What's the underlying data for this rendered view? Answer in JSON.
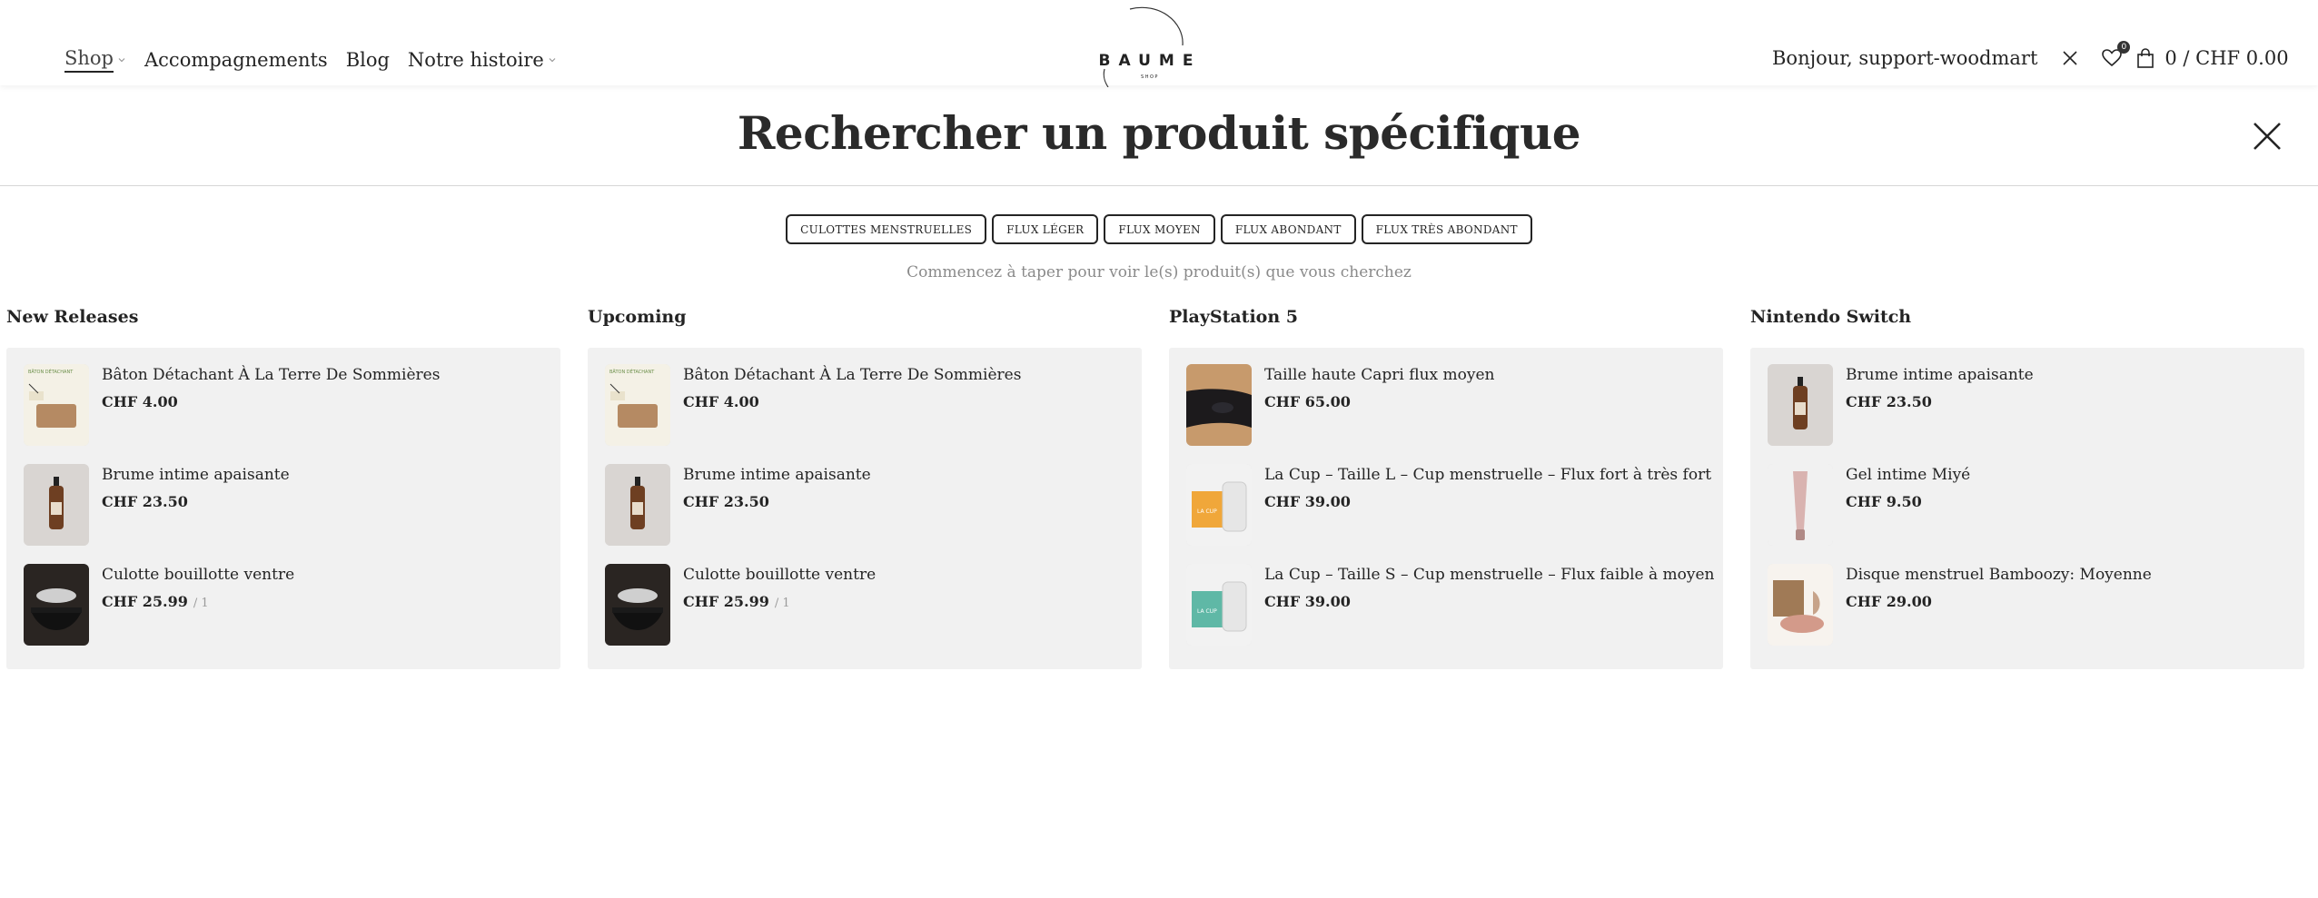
{
  "nav": {
    "items": [
      {
        "label": "Shop",
        "has_dropdown": true,
        "active": true
      },
      {
        "label": "Accompagnements",
        "has_dropdown": false
      },
      {
        "label": "Blog",
        "has_dropdown": false
      },
      {
        "label": "Notre histoire",
        "has_dropdown": true
      }
    ]
  },
  "logo": {
    "text": "BAUME",
    "subtext": "SHOP"
  },
  "account": {
    "greeting": "Bonjour, support-woodmart",
    "wishlist_count": "0",
    "cart_text": "0 / CHF 0.00"
  },
  "search": {
    "title": "Rechercher un produit spécifique",
    "tags": [
      "CULOTTES MENSTRUELLES",
      "FLUX LÉGER",
      "FLUX MOYEN",
      "FLUX ABONDANT",
      "FLUX TRÈS ABONDANT"
    ],
    "hint": "Commencez à taper pour voir le(s) produit(s) que vous cherchez"
  },
  "columns": [
    {
      "title": "New Releases",
      "products": [
        {
          "name": "Bâton Détachant À La Terre De Sommières",
          "price": "CHF 4.00",
          "qty": "",
          "thumb": "baton-thumb"
        },
        {
          "name": "Brume intime apaisante",
          "price": "CHF 23.50",
          "qty": "",
          "thumb": "spray-bottle-thumb"
        },
        {
          "name": "Culotte bouillotte ventre",
          "price": "CHF 25.99",
          "qty": "/ 1",
          "thumb": "culotte-thumb"
        }
      ]
    },
    {
      "title": "Upcoming",
      "products": [
        {
          "name": "Bâton Détachant À La Terre De Sommières",
          "price": "CHF 4.00",
          "qty": "",
          "thumb": "baton-thumb"
        },
        {
          "name": "Brume intime apaisante",
          "price": "CHF 23.50",
          "qty": "",
          "thumb": "spray-bottle-thumb"
        },
        {
          "name": "Culotte bouillotte ventre",
          "price": "CHF 25.99",
          "qty": "/ 1",
          "thumb": "culotte-thumb"
        }
      ]
    },
    {
      "title": "PlayStation 5",
      "products": [
        {
          "name": "Taille haute Capri flux moyen",
          "price": "CHF 65.00",
          "qty": "",
          "thumb": "capri-thumb"
        },
        {
          "name": "La Cup – Taille L – Cup menstruelle – Flux fort à très fort",
          "price": "CHF 39.00",
          "qty": "",
          "thumb": "cup-orange-thumb"
        },
        {
          "name": "La Cup – Taille S – Cup menstruelle – Flux faible à moyen",
          "price": "CHF 39.00",
          "qty": "",
          "thumb": "cup-teal-thumb"
        }
      ]
    },
    {
      "title": "Nintendo Switch",
      "products": [
        {
          "name": "Brume intime apaisante",
          "price": "CHF 23.50",
          "qty": "",
          "thumb": "spray-bottle-thumb"
        },
        {
          "name": "Gel intime Miyé",
          "price": "CHF 9.50",
          "qty": "",
          "thumb": "gel-tube-thumb"
        },
        {
          "name": "Disque menstruel Bamboozy: Moyenne",
          "price": "CHF 29.00",
          "qty": "",
          "thumb": "disque-thumb"
        }
      ]
    }
  ],
  "colors": {
    "text": "#242424",
    "column_bg": "#f1f1f1",
    "hint": "#8a8a8a",
    "qty": "#9a9a9a"
  }
}
